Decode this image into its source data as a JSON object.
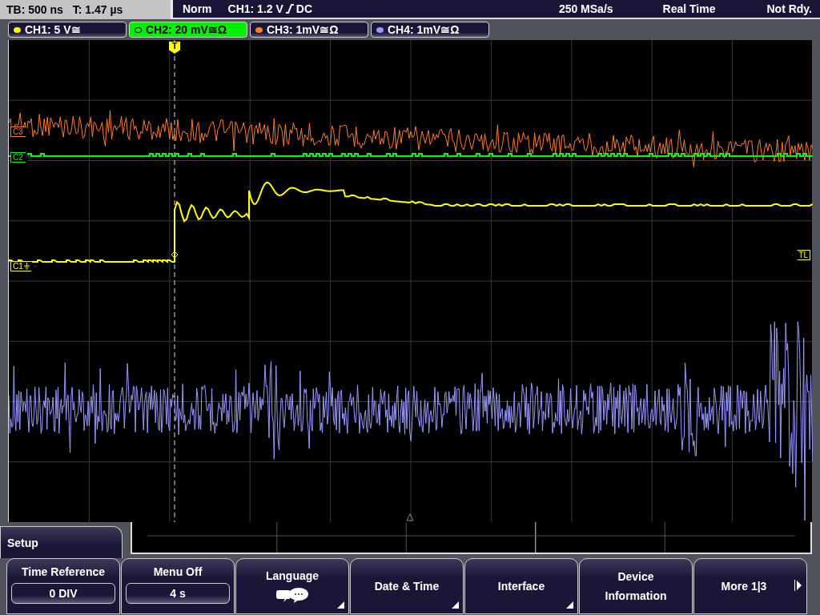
{
  "status_bar": {
    "timebase": "TB: 500 ns",
    "trigger_time": "T: 1.47 µs",
    "trigger_mode": "Norm",
    "trigger_level": "CH1: 1.2 V",
    "trigger_coupling": "DC",
    "sample_rate": "250 MSa/s",
    "acquisition": "Real Time",
    "state": "Not Rdy."
  },
  "channels": [
    {
      "label": "CH1: 5 V≅",
      "color": "#ffff00",
      "selected": false
    },
    {
      "label": "CH2: 20 mV≅Ω",
      "color": "#00ff00",
      "selected": true
    },
    {
      "label": "CH3: 1mV≅Ω",
      "color": "#ff7f27",
      "selected": false
    },
    {
      "label": "CH4: 1mV≅Ω",
      "color": "#9a9aff",
      "selected": false
    }
  ],
  "graticule": {
    "markers": [
      {
        "label": "C3",
        "kind": "channel",
        "color": "#ff7f27"
      },
      {
        "label": "C2",
        "kind": "channel",
        "color": "#00ff00"
      },
      {
        "label": "C1",
        "kind": "ground",
        "color": "#ffff00"
      },
      {
        "label": "TL",
        "kind": "level",
        "color": "#ffff00"
      }
    ],
    "trigger_marker": "T"
  },
  "menu": {
    "title": "Setup",
    "softkeys": [
      {
        "kind": "value",
        "label": "Time Reference",
        "value": "0 DIV"
      },
      {
        "kind": "value",
        "label": "Menu Off",
        "value": "4 s"
      },
      {
        "kind": "icon",
        "label": "Language",
        "submenu": true
      },
      {
        "kind": "plain",
        "label": "Date & Time",
        "submenu": true
      },
      {
        "kind": "plain",
        "label": "Interface",
        "submenu": true
      },
      {
        "kind": "plain",
        "label": "Device Information",
        "submenu": false
      },
      {
        "kind": "more",
        "label": "More 1|3",
        "submenu": false
      }
    ]
  }
}
